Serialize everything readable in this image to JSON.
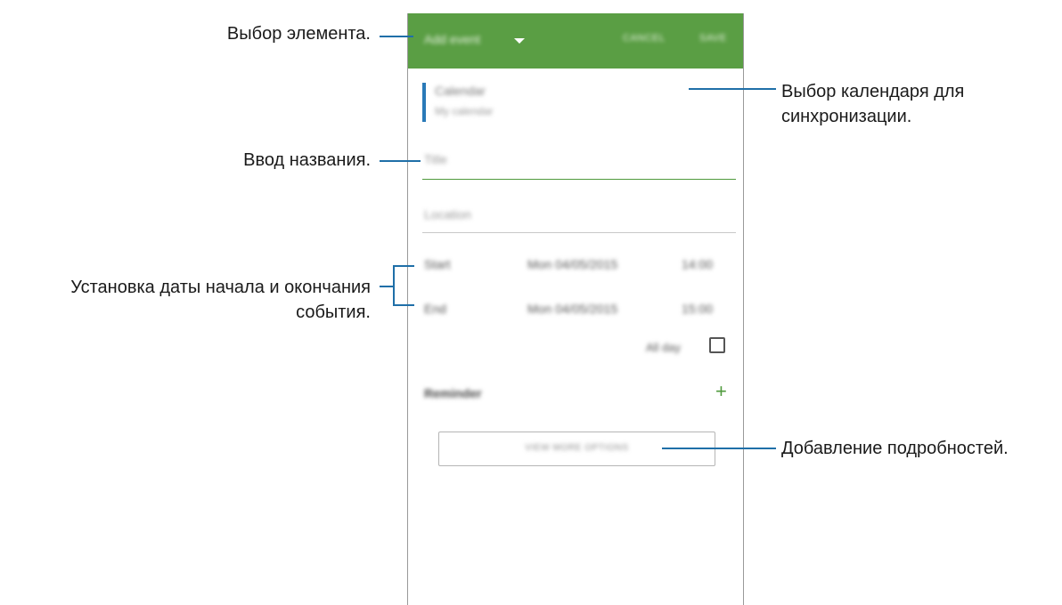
{
  "annotations": {
    "select_item": "Выбор элемента.",
    "enter_title": "Ввод названия.",
    "set_dates_line1": "Установка даты начала и окончания",
    "set_dates_line2": "события.",
    "select_calendar_line1": "Выбор календаря для",
    "select_calendar_line2": "синхронизации.",
    "add_details": "Добавление подробностей."
  },
  "app": {
    "title": "Add event",
    "cancel_label": "CANCEL",
    "save_label": "SAVE",
    "calendar": {
      "name": "Calendar",
      "sub": "My calendar"
    },
    "title_placeholder": "Title",
    "location_placeholder": "Location",
    "start": {
      "label": "Start",
      "date": "Mon 04/05/2015",
      "time": "14:00"
    },
    "end": {
      "label": "End",
      "date": "Mon 04/05/2015",
      "time": "15:00"
    },
    "all_day_label": "All day",
    "all_day_checked": false,
    "reminder_label": "Reminder",
    "more_options_label": "VIEW MORE OPTIONS"
  },
  "colors": {
    "appbar": "#5a9e44",
    "accent_green": "#4f9a3c",
    "leader_lines": "#1f6fa8",
    "calendar_bar": "#2a7ab8"
  },
  "icons": {
    "dropdown": "chevron-down-icon",
    "add_reminder": "plus-icon",
    "all_day": "checkbox-icon"
  }
}
